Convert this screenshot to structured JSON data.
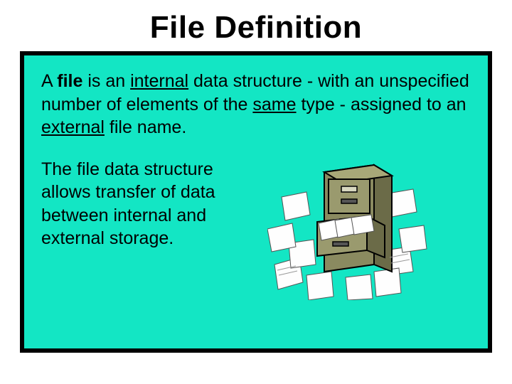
{
  "title": "File Definition",
  "definition": {
    "pre": "A ",
    "file_word": "file",
    "mid1": " is an ",
    "internal_word": "internal",
    "mid2": " data structure - with an unspecified number of elements of the ",
    "same_word": "same",
    "mid3": " type - assigned to an ",
    "external_word": "external",
    "tail": " file name."
  },
  "secondary": "The file data structure allows transfer of data between internal and external storage.",
  "colors": {
    "panel_bg": "#13e6c4",
    "border": "#000000"
  }
}
